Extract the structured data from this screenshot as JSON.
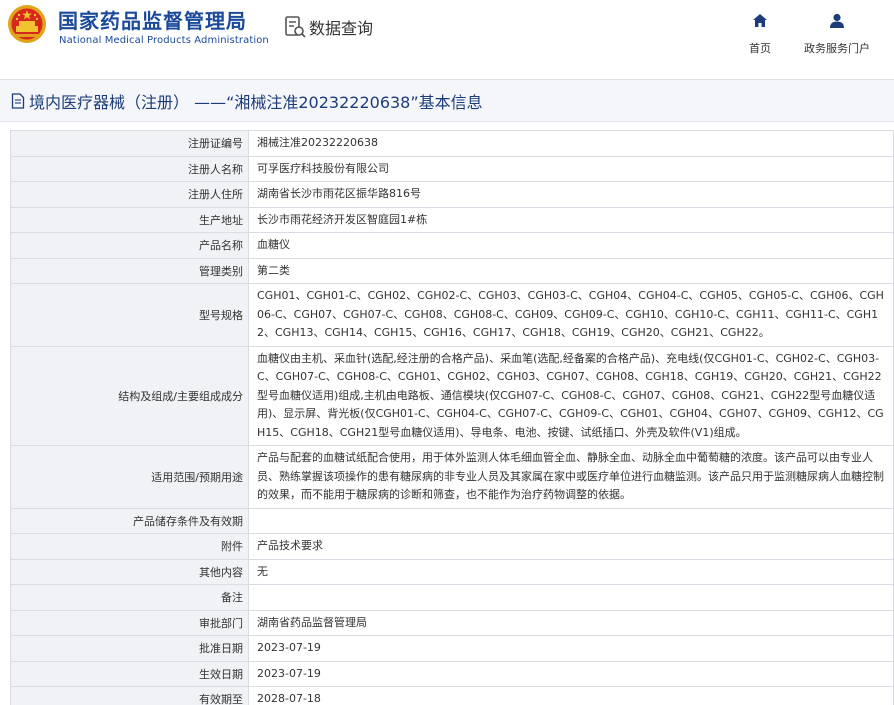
{
  "header": {
    "org_name_cn": "国家药品监督管理局",
    "org_name_en": "National Medical Products Administration",
    "emblem_icon": "national-emblem-icon",
    "data_query_label": "数据查询",
    "data_query_icon": "document-search-icon",
    "nav": [
      {
        "label": "首页",
        "icon": "home-icon"
      },
      {
        "label": "政务服务门户",
        "icon": "user-icon"
      }
    ]
  },
  "title": {
    "icon": "document-icon",
    "text": "境内医疗器械（注册） ——“湘械注准20232220638”基本信息"
  },
  "colors": {
    "brand_blue": "#1c4a9a",
    "title_blue": "#1d3d7a",
    "label_bg": "#f0f2f5",
    "border": "#d9dde3"
  },
  "rows": [
    {
      "label": "注册证编号",
      "value": "湘械注准20232220638"
    },
    {
      "label": "注册人名称",
      "value": "可孚医疗科技股份有限公司"
    },
    {
      "label": "注册人住所",
      "value": "湖南省长沙市雨花区振华路816号"
    },
    {
      "label": "生产地址",
      "value": "长沙市雨花经济开发区智庭园1#栋"
    },
    {
      "label": "产品名称",
      "value": "血糖仪"
    },
    {
      "label": "管理类别",
      "value": "第二类"
    },
    {
      "label": "型号规格",
      "value": "CGH01、CGH01-C、CGH02、CGH02-C、CGH03、CGH03-C、CGH04、CGH04-C、CGH05、CGH05-C、CGH06、CGH06-C、CGH07、CGH07-C、CGH08、CGH08-C、CGH09、CGH09-C、CGH10、CGH10-C、CGH11、CGH11-C、CGH12、CGH13、CGH14、CGH15、CGH16、CGH17、CGH18、CGH19、CGH20、CGH21、CGH22。"
    },
    {
      "label": "结构及组成/主要组成成分",
      "value": "血糖仪由主机、采血针(选配,经注册的合格产品)、采血笔(选配,经备案的合格产品)、充电线(仅CGH01-C、CGH02-C、CGH03-C、CGH07-C、CGH08-C、CGH01、CGH02、CGH03、CGH07、CGH08、CGH18、CGH19、CGH20、CGH21、CGH22型号血糖仪适用)组成,主机由电路板、通信模块(仅CGH07-C、CGH08-C、CGH07、CGH08、CGH21、CGH22型号血糖仪适用)、显示屏、背光板(仅CGH01-C、CGH04-C、CGH07-C、CGH09-C、CGH01、CGH04、CGH07、CGH09、CGH12、CGH15、CGH18、CGH21型号血糖仪适用)、导电条、电池、按键、试纸插口、外壳及软件(V1)组成。"
    },
    {
      "label": "适用范围/预期用途",
      "value": "产品与配套的血糖试纸配合使用，用于体外监测人体毛细血管全血、静脉全血、动脉全血中葡萄糖的浓度。该产品可以由专业人员、熟练掌握该项操作的患有糖尿病的非专业人员及其家属在家中或医疗单位进行血糖监测。该产品只用于监测糖尿病人血糖控制的效果，而不能用于糖尿病的诊断和筛查，也不能作为治疗药物调整的依据。"
    },
    {
      "label": "产品储存条件及有效期",
      "value": ""
    },
    {
      "label": "附件",
      "value": "产品技术要求"
    },
    {
      "label": "其他内容",
      "value": "无"
    },
    {
      "label": "备注",
      "value": ""
    },
    {
      "label": "审批部门",
      "value": "湖南省药品监督管理局"
    },
    {
      "label": "批准日期",
      "value": "2023-07-19"
    },
    {
      "label": "生效日期",
      "value": "2023-07-19"
    },
    {
      "label": "有效期至",
      "value": "2028-07-18"
    }
  ]
}
